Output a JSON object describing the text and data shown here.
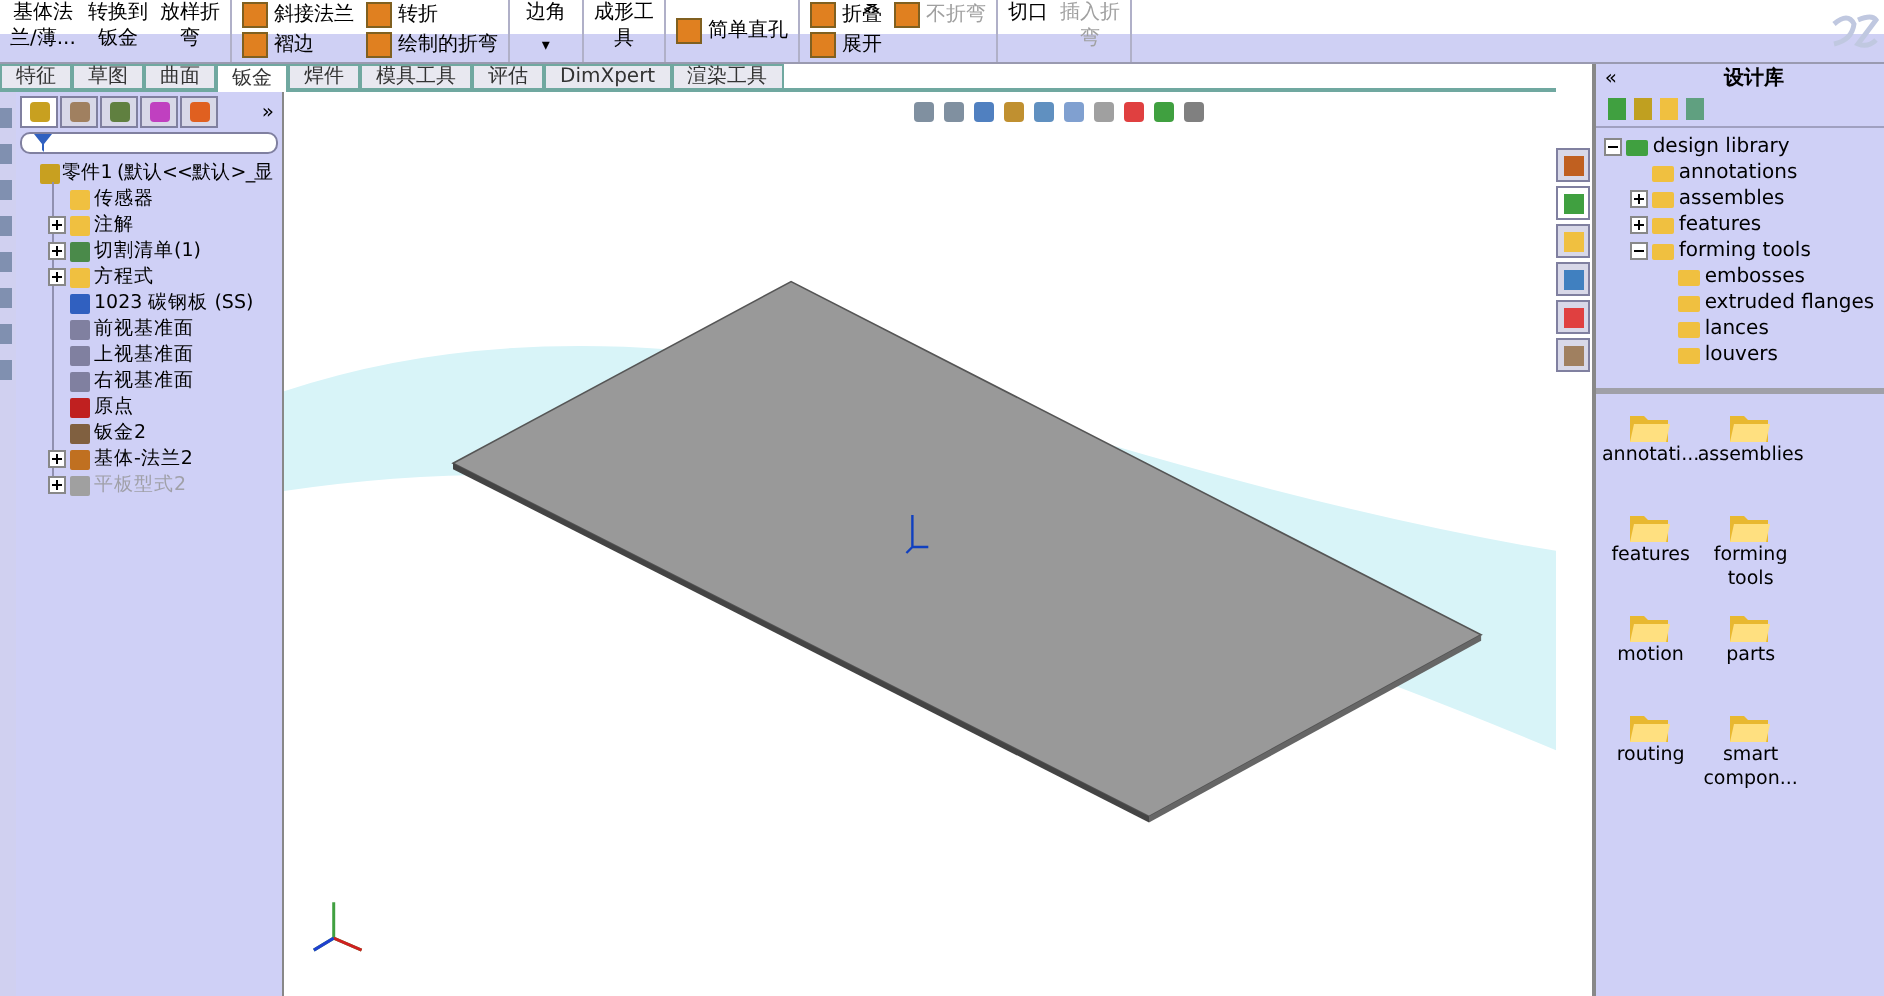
{
  "ribbon": {
    "groups": [
      {
        "buttons": [
          {
            "lines": [
              "基体法",
              "兰/薄..."
            ],
            "disabled": false,
            "kind": "big"
          },
          {
            "lines": [
              "转换到",
              "钣金"
            ],
            "disabled": false,
            "kind": "big"
          },
          {
            "lines": [
              "放样折",
              "弯"
            ],
            "disabled": false,
            "kind": "big"
          }
        ]
      },
      {
        "buttons": [
          {
            "lines": [
              "斜接法兰"
            ],
            "disabled": false,
            "kind": "small"
          },
          {
            "lines": [
              "褶边"
            ],
            "disabled": false,
            "kind": "small"
          },
          {
            "lines": [
              "转折"
            ],
            "disabled": false,
            "kind": "small"
          },
          {
            "lines": [
              "绘制的折弯"
            ],
            "disabled": false,
            "kind": "small"
          }
        ]
      },
      {
        "buttons": [
          {
            "lines": [
              "边角"
            ],
            "disabled": false,
            "kind": "drop",
            "caret": "▾"
          }
        ]
      },
      {
        "buttons": [
          {
            "lines": [
              "成形工",
              "具"
            ],
            "disabled": false,
            "kind": "big"
          }
        ]
      },
      {
        "buttons": [
          {
            "lines": [
              "简单直孔"
            ],
            "disabled": false,
            "kind": "small"
          }
        ]
      },
      {
        "buttons": [
          {
            "lines": [
              "折叠"
            ],
            "disabled": false,
            "kind": "small"
          },
          {
            "lines": [
              "展开"
            ],
            "disabled": false,
            "kind": "small"
          },
          {
            "lines": [
              "不折弯"
            ],
            "disabled": true,
            "kind": "small"
          }
        ]
      },
      {
        "buttons": [
          {
            "lines": [
              "切口"
            ],
            "disabled": false,
            "kind": "big"
          },
          {
            "lines": [
              "插入折",
              "弯"
            ],
            "disabled": true,
            "kind": "big"
          }
        ]
      }
    ]
  },
  "tabs": [
    {
      "label": "特征",
      "selected": false
    },
    {
      "label": "草图",
      "selected": false
    },
    {
      "label": "曲面",
      "selected": false
    },
    {
      "label": "钣金",
      "selected": true
    },
    {
      "label": "焊件",
      "selected": false
    },
    {
      "label": "模具工具",
      "selected": false
    },
    {
      "label": "评估",
      "selected": false
    },
    {
      "label": "DimXpert",
      "selected": false
    },
    {
      "label": "渲染工具",
      "selected": false
    }
  ],
  "feature_manager": {
    "collapse": "»",
    "tree": [
      {
        "label": "零件1 (默认<<默认>_显",
        "disabled": false,
        "expanded": true,
        "children": [
          {
            "label": "传感器",
            "disabled": false
          },
          {
            "label": "注解",
            "disabled": false,
            "expanded": false
          },
          {
            "label": "切割清单(1)",
            "disabled": false,
            "expanded": false
          },
          {
            "label": "方程式",
            "disabled": false,
            "expanded": false
          },
          {
            "label": "1023 碳钢板 (SS)",
            "disabled": false
          },
          {
            "label": "前视基准面",
            "disabled": false
          },
          {
            "label": "上视基准面",
            "disabled": false
          },
          {
            "label": "右视基准面",
            "disabled": false
          },
          {
            "label": "原点",
            "disabled": false
          },
          {
            "label": "钣金2",
            "disabled": false
          },
          {
            "label": "基体-法兰2",
            "disabled": false,
            "expanded": false
          },
          {
            "label": "平板型式2",
            "disabled": true,
            "expanded": false
          }
        ]
      }
    ]
  },
  "design_library": {
    "collapse": "«",
    "title": "设计库",
    "tree": [
      {
        "label": "design library",
        "expanded": true,
        "children": [
          {
            "label": "annotations"
          },
          {
            "label": "assembles",
            "expanded": false
          },
          {
            "label": "features",
            "expanded": false
          },
          {
            "label": "forming tools",
            "expanded": true,
            "children": [
              {
                "label": "embosses"
              },
              {
                "label": "extruded flanges"
              },
              {
                "label": "lances"
              },
              {
                "label": "louvers"
              }
            ]
          }
        ]
      }
    ],
    "folders": [
      {
        "lines": [
          "annotati..."
        ]
      },
      {
        "lines": [
          "assemblies"
        ]
      },
      {
        "lines": [
          "features"
        ]
      },
      {
        "lines": [
          "forming",
          "tools"
        ]
      },
      {
        "lines": [
          "motion"
        ]
      },
      {
        "lines": [
          "parts"
        ]
      },
      {
        "lines": [
          "routing"
        ]
      },
      {
        "lines": [
          "smart",
          "compon..."
        ]
      }
    ]
  }
}
